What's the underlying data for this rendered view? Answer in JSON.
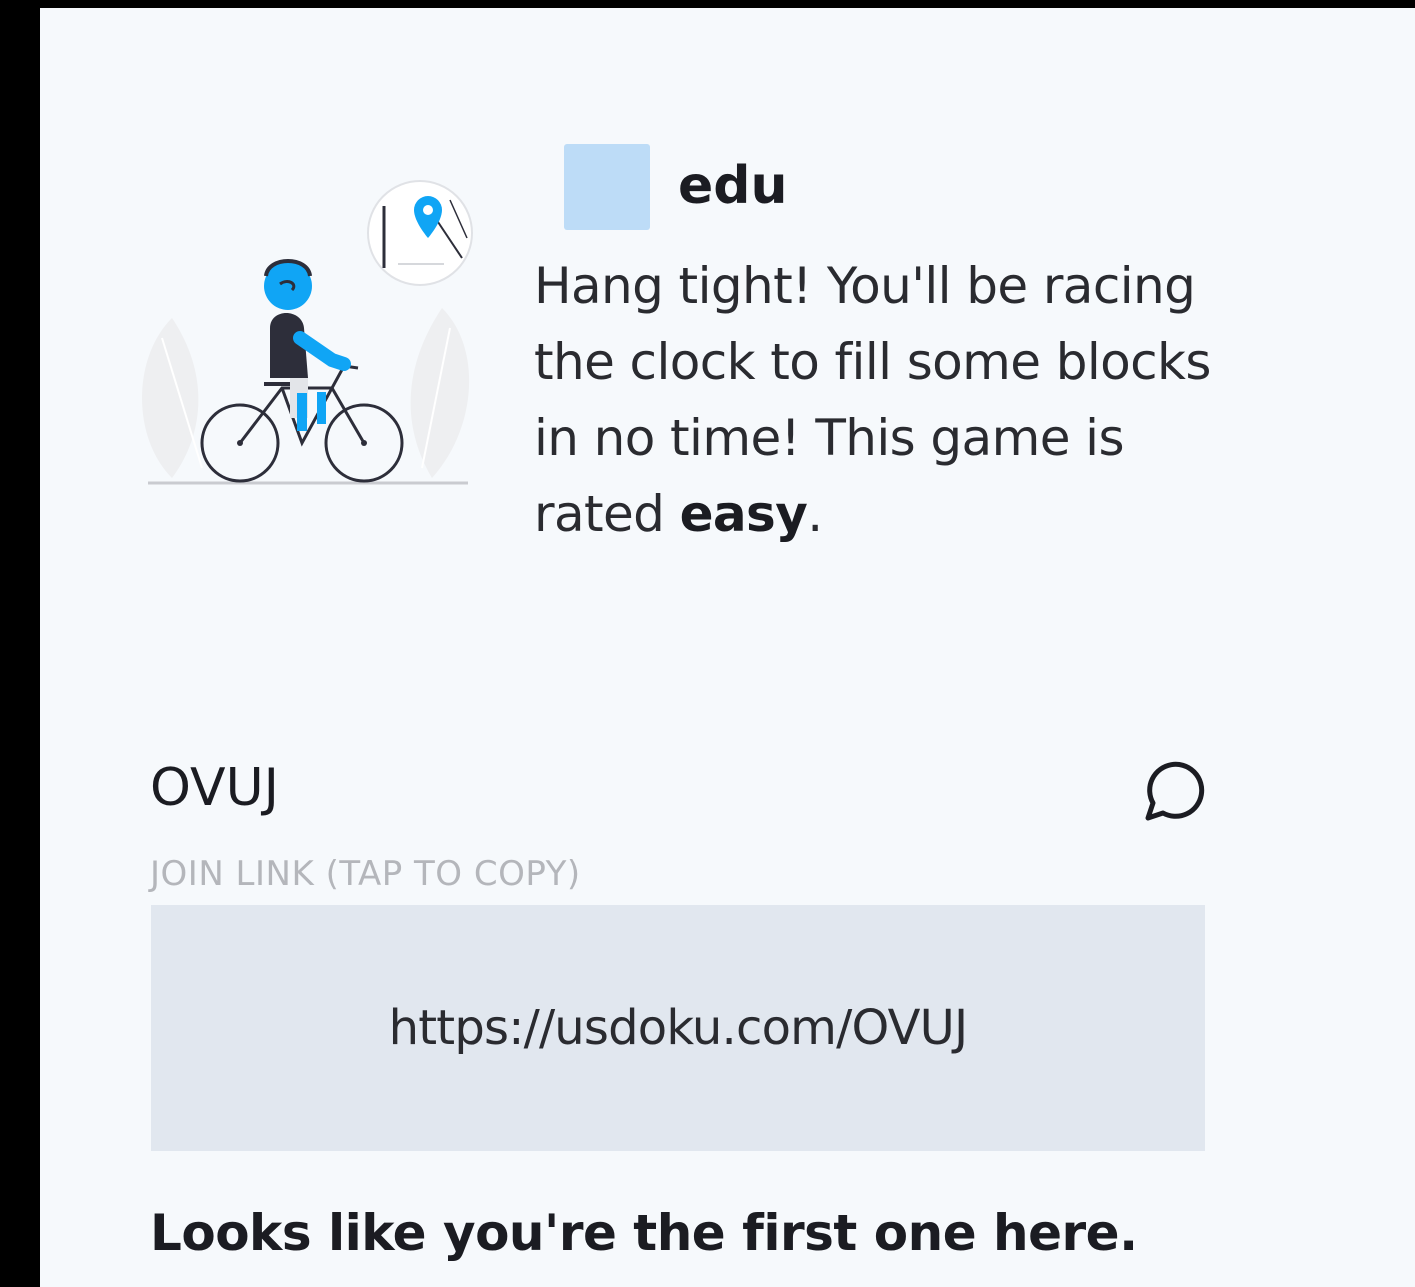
{
  "player": {
    "name": "edu",
    "avatar_color": "#bddcf7"
  },
  "intro": {
    "message_prefix": "Hang tight! You'll be racing the clock to fill some blocks in no time! This game is rated ",
    "difficulty": "easy",
    "message_suffix": "."
  },
  "game": {
    "code": "OVUJ",
    "join_label": "JOIN LINK (TAP TO COPY)",
    "join_link": "https://usdoku.com/OVUJ"
  },
  "status": {
    "message": "Looks like you're the first one here."
  },
  "icons": {
    "chat": "chat-bubble-icon",
    "illustration": "cyclist-illustration"
  },
  "colors": {
    "accent": "#10a5f5",
    "panel_bg": "#f6f9fc",
    "link_box_bg": "#e1e7ef"
  }
}
